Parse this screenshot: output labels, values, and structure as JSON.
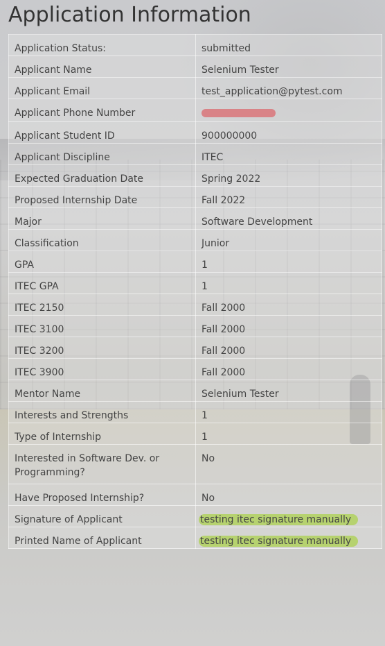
{
  "page": {
    "title": "Application Information"
  },
  "rows": [
    {
      "label": "Application Status:",
      "value": "submitted"
    },
    {
      "label": "Applicant Name",
      "value": "Selenium Tester"
    },
    {
      "label": "Applicant Email",
      "value": "test_application@pytest.com"
    },
    {
      "label": "Applicant Phone Number",
      "value": ""
    },
    {
      "label": "Applicant Student ID",
      "value": "900000000"
    },
    {
      "label": "Applicant Discipline",
      "value": "ITEC"
    },
    {
      "label": "Expected Graduation Date",
      "value": "Spring 2022"
    },
    {
      "label": "Proposed Internship Date",
      "value": "Fall 2022"
    },
    {
      "label": "Major",
      "value": "Software Development"
    },
    {
      "label": "Classification",
      "value": "Junior"
    },
    {
      "label": "GPA",
      "value": "1"
    },
    {
      "label": "ITEC GPA",
      "value": "1"
    },
    {
      "label": "ITEC 2150",
      "value": "Fall 2000"
    },
    {
      "label": "ITEC 3100",
      "value": "Fall 2000"
    },
    {
      "label": "ITEC 3200",
      "value": "Fall 2000"
    },
    {
      "label": "ITEC 3900",
      "value": "Fall 2000"
    },
    {
      "label": "Mentor Name",
      "value": "Selenium Tester"
    },
    {
      "label": "Interests and Strengths",
      "value": "1"
    },
    {
      "label": "Type of Internship",
      "value": "1"
    },
    {
      "label": "Interested in Software Dev. or Programming?",
      "value": "No"
    },
    {
      "label": "Have Proposed Internship?",
      "value": "No"
    },
    {
      "label": "Signature of Applicant",
      "value": "testing itec signature manually"
    },
    {
      "label": "Printed Name of Applicant",
      "value": "testing itec signature manually"
    }
  ],
  "colors": {
    "redaction": "#d97a7e",
    "highlight": "#b6d26f"
  }
}
